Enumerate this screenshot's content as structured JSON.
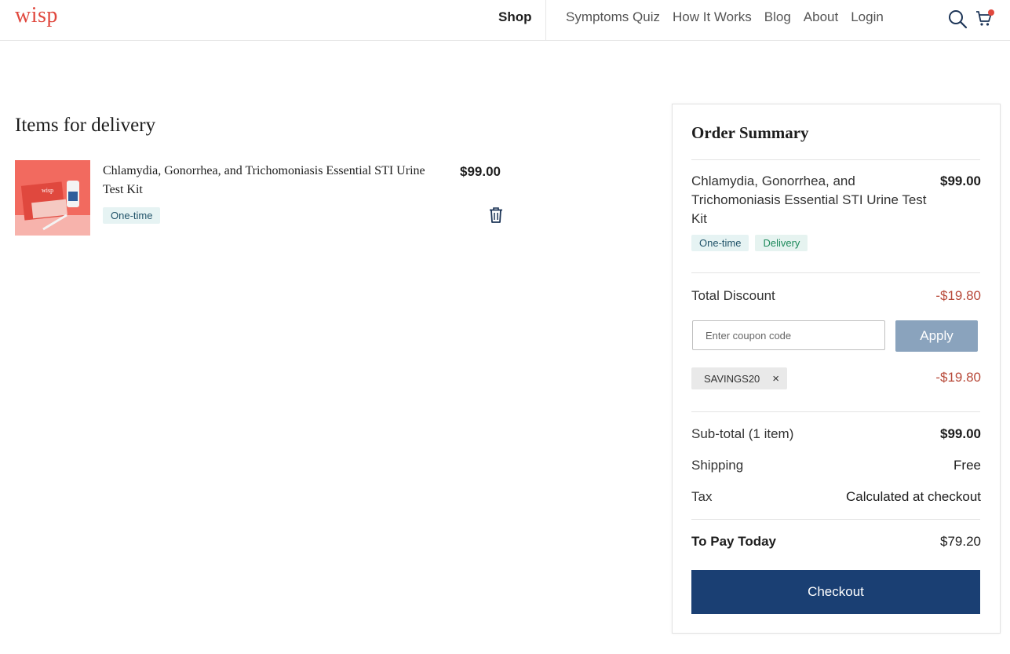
{
  "header": {
    "logo": "wisp",
    "nav_active": "Shop",
    "nav_links": [
      "Symptoms Quiz",
      "How It Works",
      "Blog",
      "About",
      "Login"
    ],
    "icons": [
      "search-icon",
      "cart-icon"
    ],
    "cart_dot_color": "#e0483e"
  },
  "cart": {
    "title": "Items for delivery",
    "item": {
      "name": "Chlamydia, Gonorrhea, and Trichomoniasis Essential STI Urine Test Kit",
      "price": "$99.00",
      "tag": "One-time",
      "thumb_label": "wisp"
    }
  },
  "summary": {
    "title": "Order Summary",
    "product": {
      "name": "Chlamydia, Gonorrhea, and Trichomoniasis Essential STI Urine Test Kit",
      "price": "$99.00",
      "tags": [
        "One-time",
        "Delivery"
      ]
    },
    "total_discount_label": "Total Discount",
    "total_discount_value": "-$19.80",
    "coupon_placeholder": "Enter coupon code",
    "apply_label": "Apply",
    "applied_coupon": "SAVINGS20",
    "applied_coupon_remove": "×",
    "applied_coupon_value": "-$19.80",
    "subtotal_label": "Sub-total (1 item)",
    "subtotal_value": "$99.00",
    "shipping_label": "Shipping",
    "shipping_value": "Free",
    "tax_label": "Tax",
    "tax_value": "Calculated at checkout",
    "to_pay_label": "To Pay Today",
    "to_pay_value": "$79.20",
    "checkout_label": "Checkout"
  },
  "colors": {
    "brand": "#e0483e",
    "checkout": "#1a3f73",
    "apply": "#8aa3bd",
    "discount": "#b84a3a"
  }
}
